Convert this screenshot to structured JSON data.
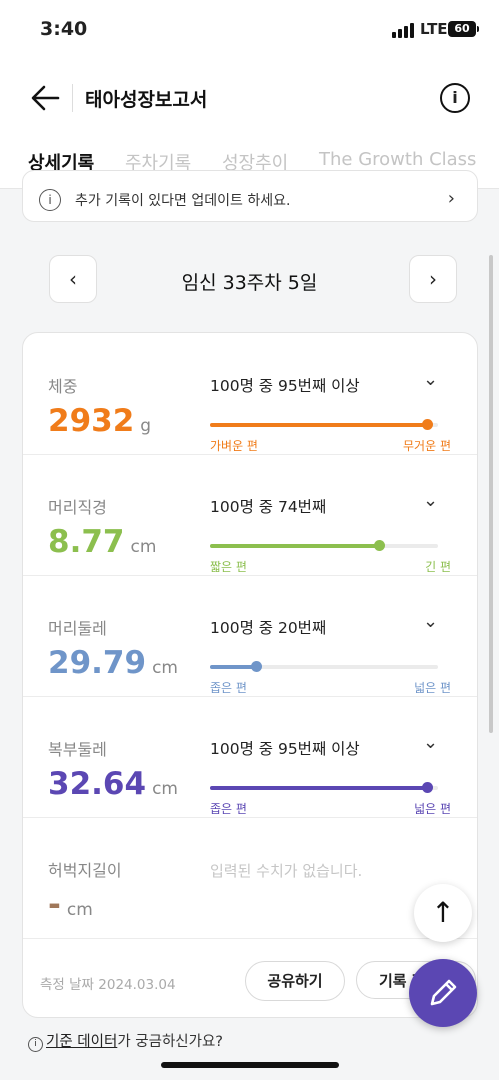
{
  "status": {
    "time": "3:40",
    "network": "LTE",
    "battery": "60"
  },
  "header": {
    "title": "태아성장보고서",
    "info_icon": "i"
  },
  "tabs": [
    {
      "label": "상세기록",
      "active": true
    },
    {
      "label": "주차기록",
      "active": false
    },
    {
      "label": "성장추이",
      "active": false
    },
    {
      "label": "The Growth Class",
      "active": false
    }
  ],
  "notice": {
    "icon": "i",
    "text": "추가 기록이 있다면 업데이트 하세요.",
    "chevron": "›"
  },
  "week": {
    "label": "임신 33주차 5일",
    "prev": "‹",
    "next": "›"
  },
  "measurements": [
    {
      "label": "체중",
      "value": "2932",
      "unit": "g",
      "rank": "100명 중 95번째 이상",
      "percentile": 0.95,
      "low_label": "가벼운 편",
      "high_label": "무거운 편",
      "color": "#f07c1a"
    },
    {
      "label": "머리직경",
      "value": "8.77",
      "unit": "cm",
      "rank": "100명 중 74번째",
      "percentile": 0.74,
      "low_label": "짧은 편",
      "high_label": "긴 편",
      "color": "#8cbf4e"
    },
    {
      "label": "머리둘레",
      "value": "29.79",
      "unit": "cm",
      "rank": "100명 중 20번째",
      "percentile": 0.2,
      "low_label": "좁은 편",
      "high_label": "넓은 편",
      "color": "#6f95c9"
    },
    {
      "label": "복부둘레",
      "value": "32.64",
      "unit": "cm",
      "rank": "100명 중 95번째 이상",
      "percentile": 0.95,
      "low_label": "좁은 편",
      "high_label": "넓은 편",
      "color": "#5b47b3"
    },
    {
      "label": "허벅지길이",
      "value": "-",
      "unit": "cm",
      "rank": "",
      "empty_text": "입력된 수치가 없습니다.",
      "color": "#a0785a"
    }
  ],
  "footer": {
    "date": "측정 날짜 2024.03.04",
    "share": "공유하기",
    "record": "기록 편"
  },
  "bottom_link": {
    "icon": "i",
    "link_text": "기준 데이터",
    "rest": "가 궁금하신가요?"
  },
  "fab": {
    "up": "↑"
  }
}
